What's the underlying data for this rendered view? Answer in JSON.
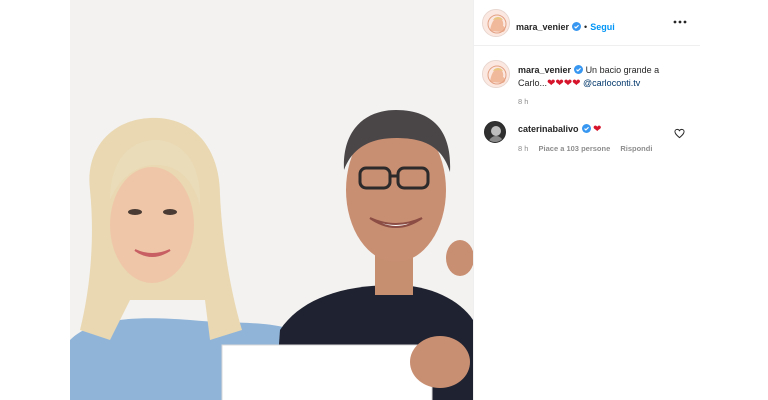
{
  "post": {
    "author": "mara_venier",
    "follow_label": "Segui",
    "separator": "•",
    "caption_text": "Un bacio grande a Carlo...",
    "caption_hearts": "❤❤❤❤",
    "caption_mention": "@carloconti.tv",
    "caption_time": "8 h"
  },
  "comments": [
    {
      "author": "caterinabalivo",
      "hearts": "❤",
      "time": "8 h",
      "likes": "Piace a 103 persone",
      "reply_label": "Rispondi"
    }
  ],
  "colors": {
    "accent": "#0095f6",
    "verified": "#3897f0",
    "heart": "#d6142b",
    "muted": "#8e8e8e"
  },
  "icons": {
    "more": "more-horizontal-icon",
    "verified": "verified-badge-icon",
    "like": "heart-outline-icon"
  }
}
